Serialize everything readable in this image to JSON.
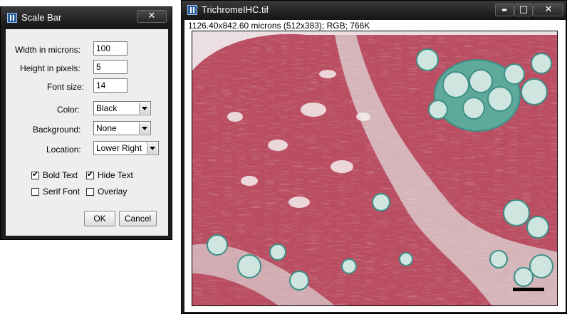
{
  "dialog": {
    "title": "Scale Bar",
    "width_label": "Width in microns:",
    "width_value": "100",
    "height_label": "Height in pixels:",
    "height_value": "5",
    "font_label": "Font size:",
    "font_value": "14",
    "color_label": "Color:",
    "color_value": "Black",
    "background_label": "Background:",
    "background_value": "None",
    "location_label": "Location:",
    "location_value": "Lower Right",
    "bold_label": "Bold Text",
    "bold_checked": true,
    "hide_label": "Hide Text",
    "hide_checked": true,
    "serif_label": "Serif Font",
    "serif_checked": false,
    "overlay_label": "Overlay",
    "overlay_checked": false,
    "ok_label": "OK",
    "cancel_label": "Cancel",
    "close_glyph": "✕"
  },
  "image_window": {
    "title": "TrichromeIHC.tif",
    "info": "1126.40x842.60 microns (512x383); RGB; 766K",
    "minimize_glyph": "▬",
    "maximize_glyph": "□",
    "close_glyph": "✕"
  },
  "colors": {
    "tissue_red": "#b8465a",
    "tissue_green": "#6fb8a6",
    "background_white": "#f2eeee"
  }
}
